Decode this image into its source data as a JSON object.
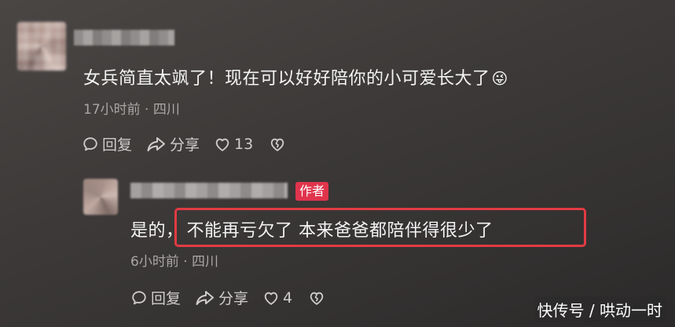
{
  "comment": {
    "text": "女兵简直太飒了！现在可以好好陪你的小可爱长大了",
    "emoji": "😜",
    "meta": "17小时前 · 四川",
    "reply_label": "回复",
    "share_label": "分享",
    "like_count": "13"
  },
  "reply": {
    "badge": "作者",
    "text_prefix": "是的，",
    "text_highlight": "不能再亏欠了  本来爸爸都陪伴得很少了",
    "meta": "6小时前 · 四川",
    "reply_label": "回复",
    "share_label": "分享",
    "like_count": "4"
  },
  "watermark": "快传号 / 哄动一时",
  "colors": {
    "badge": "#e0344c",
    "highlight_border": "#e23b42",
    "meta_text": "#a9a6a5"
  },
  "icons": [
    "comment-bubble-icon",
    "share-arrow-icon",
    "heart-icon",
    "broken-heart-icon"
  ]
}
